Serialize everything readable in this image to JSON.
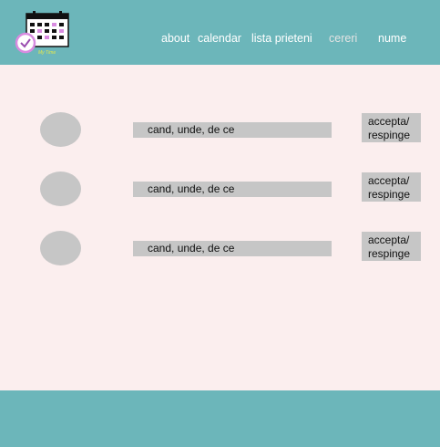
{
  "header": {
    "logo_icon": "calendar-clock-logo",
    "logo_text": "My Time",
    "nav": [
      {
        "label": "about"
      },
      {
        "label": "calendar"
      },
      {
        "label": "lista prieteni"
      },
      {
        "label": "cereri"
      },
      {
        "label": "nume"
      }
    ]
  },
  "requests": [
    {
      "info": "cand, unde, de ce",
      "action": "accepta/ respinge"
    },
    {
      "info": "cand, unde, de ce",
      "action": "accepta/ respinge"
    },
    {
      "info": "cand, unde, de ce",
      "action": "accepta/ respinge"
    }
  ],
  "colors": {
    "header_bg": "#6cb6ba",
    "page_bg": "#fbeeee",
    "placeholder_gray": "#c6c6c6",
    "logo_accent": "#d88be0"
  }
}
